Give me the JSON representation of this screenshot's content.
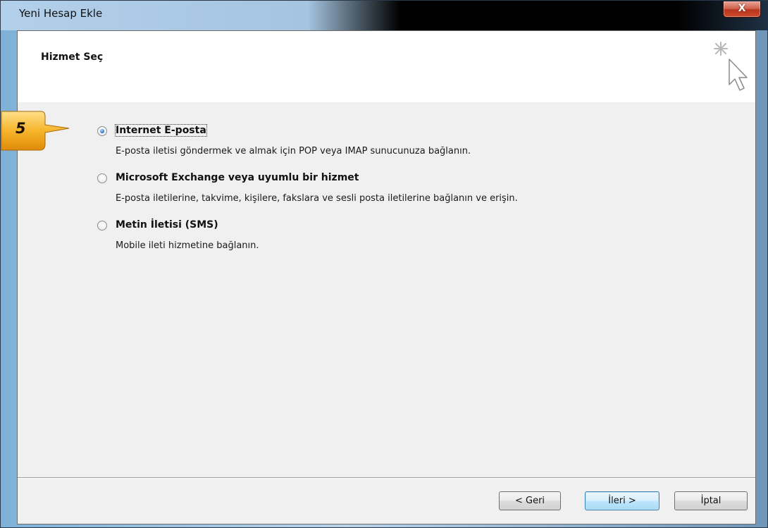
{
  "window": {
    "title": "Yeni Hesap Ekle",
    "close_label": "X"
  },
  "header": {
    "title": "Hizmet Seç"
  },
  "callout": {
    "step": "5"
  },
  "options": [
    {
      "label": "Internet E-posta",
      "description": "E-posta iletisi göndermek ve almak için POP veya IMAP sunucunuza bağlanın.",
      "selected": true
    },
    {
      "label": "Microsoft Exchange veya uyumlu bir hizmet",
      "description": "E-posta iletilerine, takvime, kişilere, fakslara ve sesli posta iletilerine bağlanın ve erişin.",
      "selected": false
    },
    {
      "label": "Metin İletisi (SMS)",
      "description": "Mobile ileti hizmetine bağlanın.",
      "selected": false
    }
  ],
  "buttons": {
    "back": "< Geri",
    "next": "İleri >",
    "cancel": "İptal"
  },
  "colors": {
    "accent": "#3c7fb1",
    "callout": "#f2a514"
  }
}
